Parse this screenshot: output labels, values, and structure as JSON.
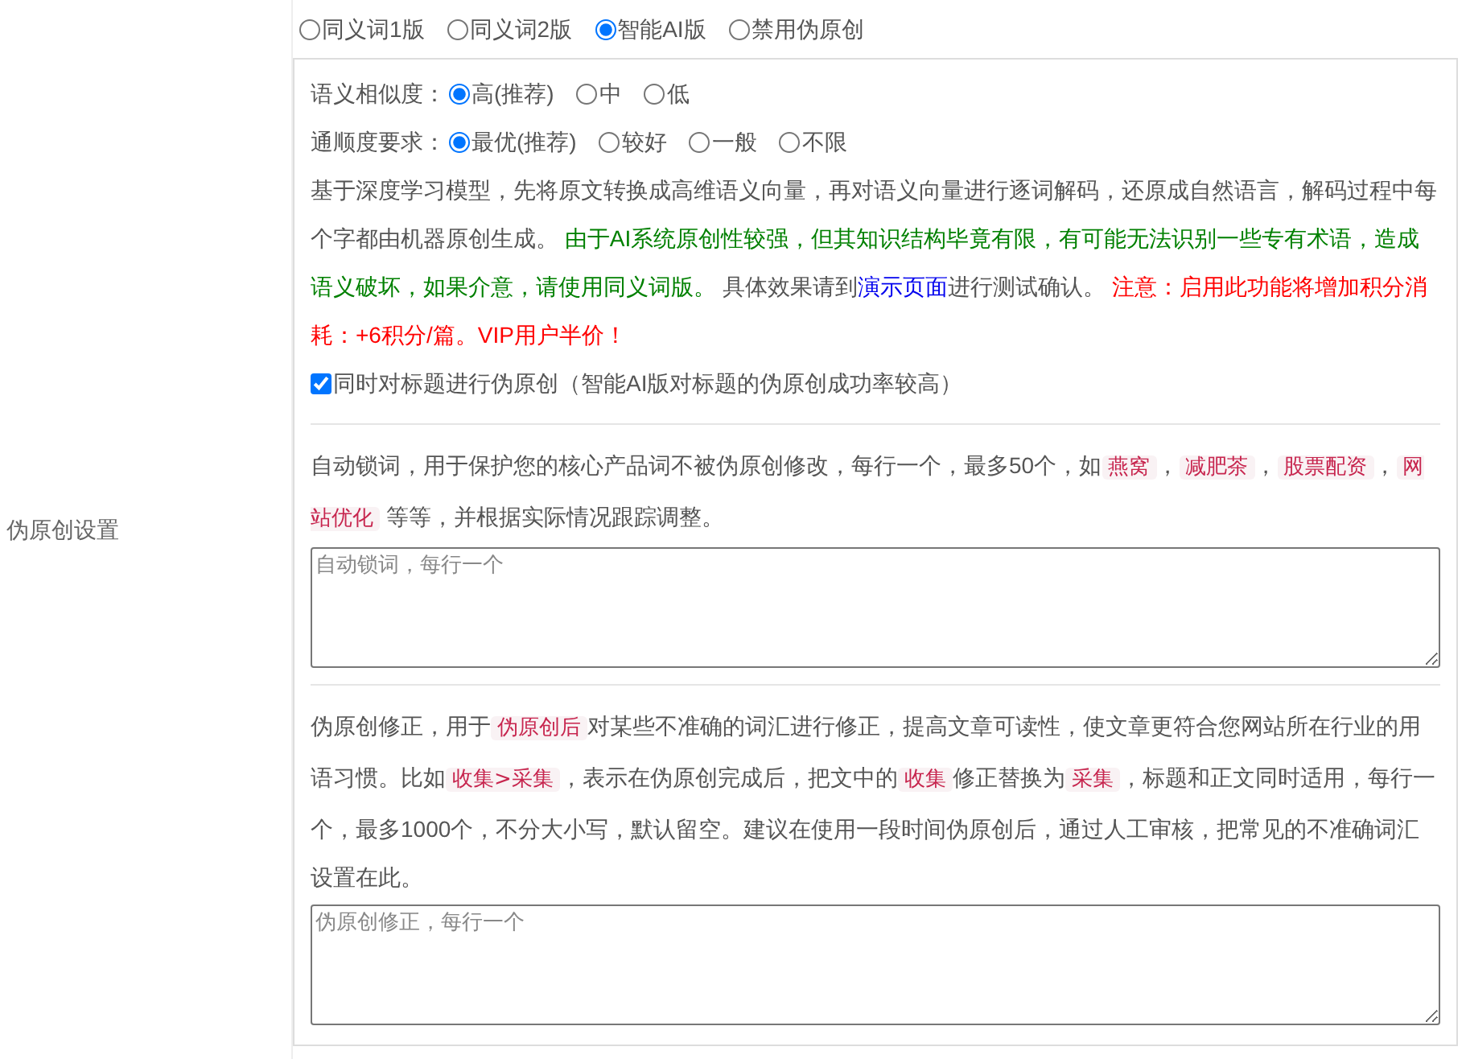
{
  "section_label": "伪原创设置",
  "modes": [
    {
      "label": "同义词1版",
      "selected": false
    },
    {
      "label": "同义词2版",
      "selected": false
    },
    {
      "label": "智能AI版",
      "selected": true
    },
    {
      "label": "禁用伪原创",
      "selected": false
    }
  ],
  "similarity": {
    "label": "语义相似度：",
    "options": [
      {
        "label": "高(推荐)",
        "selected": true
      },
      {
        "label": "中",
        "selected": false
      },
      {
        "label": "低",
        "selected": false
      }
    ]
  },
  "fluency": {
    "label": "通顺度要求：",
    "options": [
      {
        "label": "最优(推荐)",
        "selected": true
      },
      {
        "label": "较好",
        "selected": false
      },
      {
        "label": "一般",
        "selected": false
      },
      {
        "label": "不限",
        "selected": false
      }
    ]
  },
  "description": [
    {
      "kind": "plain",
      "text": "基于深度学习模型，先将原文转换成高维语义向量，再对语义向量进行逐词解码，还原成自然语言，解码过程中每个字都由机器原创生成。 "
    },
    {
      "kind": "note",
      "text": "由于AI系统原创性较强，但其知识结构毕竟有限，有可能无法识别一些专有术语，造成语义破坏，如果介意，请使用同义词版。"
    },
    {
      "kind": "plain",
      "text": " 具体效果请到"
    },
    {
      "kind": "link",
      "text": "演示页面"
    },
    {
      "kind": "plain",
      "text": "进行测试确认。 "
    },
    {
      "kind": "warning",
      "text": "注意：启用此功能将增加积分消耗：+6积分/篇。VIP用户半价！"
    }
  ],
  "title_option": {
    "label": "同时对标题进行伪原创（智能AI版对标题的伪原创成功率较高）",
    "checked": true
  },
  "lock_words": {
    "description": [
      {
        "kind": "plain",
        "text": "自动锁词，用于保护您的核心产品词不被伪原创修改，每行一个，最多50个，如"
      },
      {
        "kind": "code",
        "text": "燕窝"
      },
      {
        "kind": "plain",
        "text": "，"
      },
      {
        "kind": "code",
        "text": "减肥茶"
      },
      {
        "kind": "plain",
        "text": "，"
      },
      {
        "kind": "code",
        "text": "股票配资"
      },
      {
        "kind": "plain",
        "text": "，"
      },
      {
        "kind": "code",
        "text": "网站优化"
      },
      {
        "kind": "plain",
        "text": " 等等，并根据实际情况跟踪调整。"
      }
    ],
    "placeholder": "自动锁词，每行一个"
  },
  "corrections": {
    "description": [
      {
        "kind": "plain",
        "text": "伪原创修正，用于"
      },
      {
        "kind": "code",
        "text": "伪原创后"
      },
      {
        "kind": "plain",
        "text": "对某些不准确的词汇进行修正，提高文章可读性，使文章更符合您网站所在行业的用语习惯。比如"
      },
      {
        "kind": "code",
        "text": "收集>采集"
      },
      {
        "kind": "plain",
        "text": "，表示在伪原创完成后，把文中的"
      },
      {
        "kind": "code",
        "text": "收集"
      },
      {
        "kind": "plain",
        "text": "修正替换为"
      },
      {
        "kind": "code",
        "text": "采集"
      },
      {
        "kind": "plain",
        "text": "，标题和正文同时适用，每行一个，最多1000个，不分大小写，默认留空。建议在使用一段时间伪原创后，通过人工审核，把常见的不准确词汇设置在此。"
      }
    ],
    "placeholder": "伪原创修正，每行一个"
  }
}
